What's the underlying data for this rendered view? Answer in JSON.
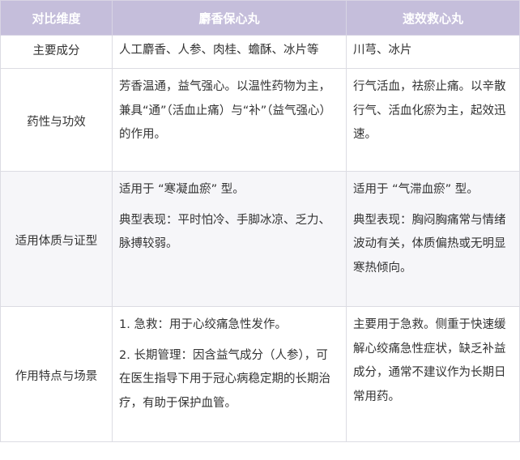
{
  "headers": [
    "对比维度",
    "麝香保心丸",
    "速效救心丸"
  ],
  "rows": [
    {
      "label": "主要成分",
      "a": [
        "人工麝香、人参、肉桂、蟾酥、冰片等"
      ],
      "b": [
        "川芎、冰片"
      ]
    },
    {
      "label": "药性与功效",
      "a": [
        "芳香温通，益气强心。以温性药物为主，兼具“通”（活血止痛）与“补”（益气强心）的作用。"
      ],
      "b": [
        "行气活血，祛瘀止痛。以辛散行气、活血化瘀为主，起效迅速。"
      ]
    },
    {
      "label": "适用体质与证型",
      "a": [
        "适用于 “寒凝血瘀” 型。",
        "典型表现：平时怕冷、手脚冰凉、乏力、脉搏较弱。"
      ],
      "b": [
        "适用于 “气滞血瘀” 型。",
        "典型表现：胸闷胸痛常与情绪波动有关，体质偏热或无明显寒热倾向。"
      ]
    },
    {
      "label": "作用特点与场景",
      "a": [
        "1. 急救：用于心绞痛急性发作。",
        "2. 长期管理：因含益气成分（人参），可在医生指导下用于冠心病稳定期的长期治疗，有助于保护血管。"
      ],
      "b": [
        "主要用于急救。侧重于快速缓解心绞痛急性症状，缺乏补益成分，通常不建议作为长期日常用药。"
      ]
    }
  ]
}
